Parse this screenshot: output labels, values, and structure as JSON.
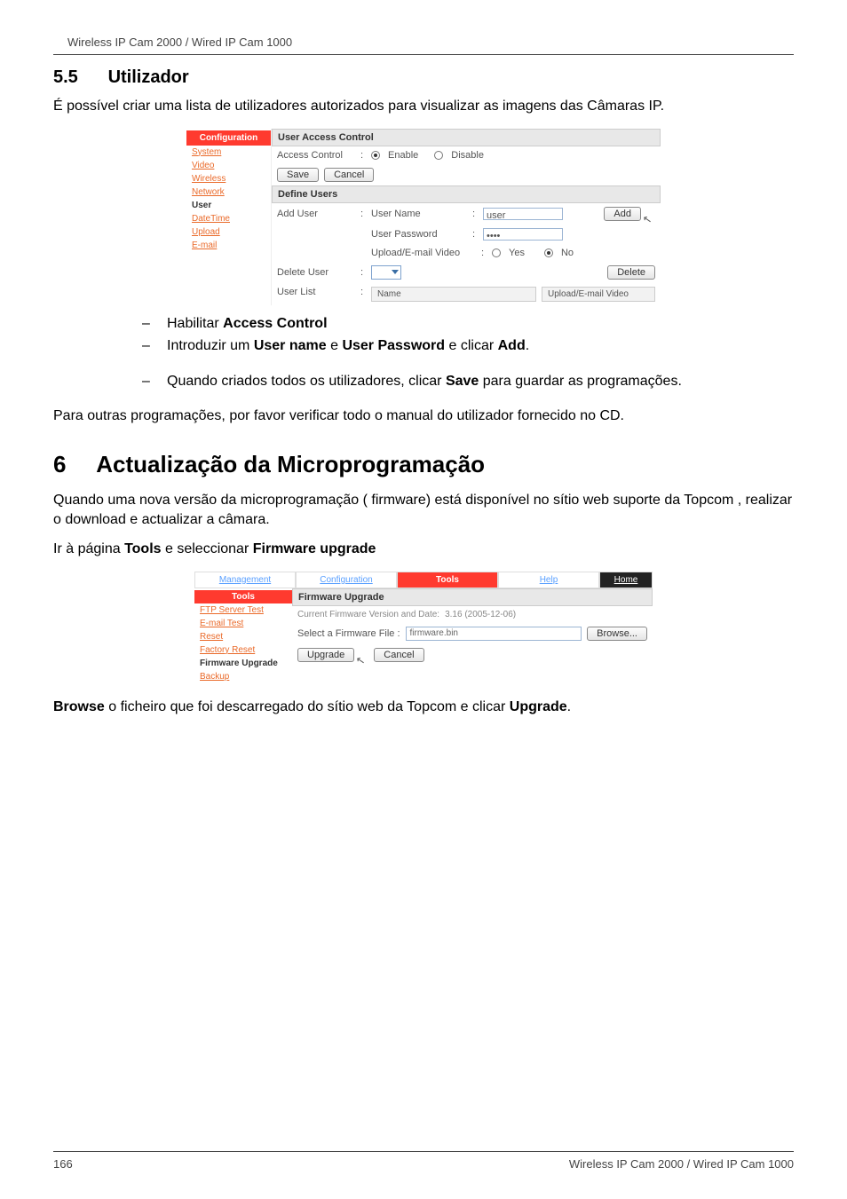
{
  "header": {
    "product": "Wireless IP Cam 2000 / Wired IP Cam 1000"
  },
  "section55": {
    "number": "5.5",
    "title": "Utilizador",
    "intro": "É possível criar uma lista de utilizadores autorizados para visualizar as imagens das Câmaras IP."
  },
  "shot1": {
    "sidebar": {
      "header": "Configuration",
      "items": [
        "System",
        "Video",
        "Wireless",
        "Network",
        "User",
        "DateTime",
        "Upload",
        "E-mail"
      ],
      "selected": "User"
    },
    "uac": {
      "section_title": "User Access Control",
      "access_control_label": "Access Control",
      "enable": "Enable",
      "disable": "Disable",
      "save": "Save",
      "cancel": "Cancel"
    },
    "define": {
      "section_title": "Define Users",
      "add_user_label": "Add User",
      "username_label": "User Name",
      "username_value": "user",
      "password_label": "User Password",
      "password_value": "••••",
      "upload_label": "Upload/E-mail Video",
      "yes": "Yes",
      "no": "No",
      "add_btn": "Add",
      "delete_user_label": "Delete User",
      "delete_btn": "Delete",
      "userlist_label": "User List",
      "th_name": "Name",
      "th_upload": "Upload/E-mail Video"
    }
  },
  "instructions1": {
    "l1_pre": "Habilitar ",
    "l1_b": "Access Control",
    "l2_pre": "Introduzir um ",
    "l2_b1": "User name",
    "l2_mid": " e ",
    "l2_b2": "User Password",
    "l2_mid2": " e clicar ",
    "l2_b3": "Add",
    "l2_post": ".",
    "l3_pre": "Quando criados todos os utilizadores, clicar ",
    "l3_b": "Save",
    "l3_post": " para guardar as programações."
  },
  "closing55": "Para outras programações, por favor verificar todo o manual do utilizador fornecido no CD.",
  "section6": {
    "number": "6",
    "title": "Actualização da Microprogramação",
    "intro": "Quando uma nova versão da microprogramação ( firmware) está disponível no sítio web suporte da Topcom , realizar o download e actualizar a câmara.",
    "step_pre": "Ir à página ",
    "step_b1": "Tools",
    "step_mid": " e seleccionar ",
    "step_b2": "Firmware upgrade"
  },
  "shot2": {
    "tabs": {
      "management": "Management",
      "configuration": "Configuration",
      "tools": "Tools",
      "help": "Help",
      "home": "Home"
    },
    "sidebar": {
      "header": "Tools",
      "items": [
        "FTP Server Test",
        "E-mail Test",
        "Reset",
        "Factory Reset",
        "Firmware Upgrade",
        "Backup"
      ],
      "selected": "Firmware Upgrade"
    },
    "panel": {
      "title": "Firmware Upgrade",
      "version_label": "Current Firmware Version and Date:",
      "version_value": "3.16 (2005-12-06)",
      "select_label": "Select a Firmware File :",
      "file_value": "firmware.bin",
      "browse": "Browse...",
      "upgrade": "Upgrade",
      "cancel": "Cancel"
    }
  },
  "closing6": {
    "b1": "Browse",
    "mid": " o ficheiro que foi descarregado do sítio web da Topcom e clicar ",
    "b2": "Upgrade",
    "post": "."
  },
  "footer": {
    "page": "166",
    "product": "Wireless IP Cam 2000 / Wired IP Cam 1000"
  }
}
